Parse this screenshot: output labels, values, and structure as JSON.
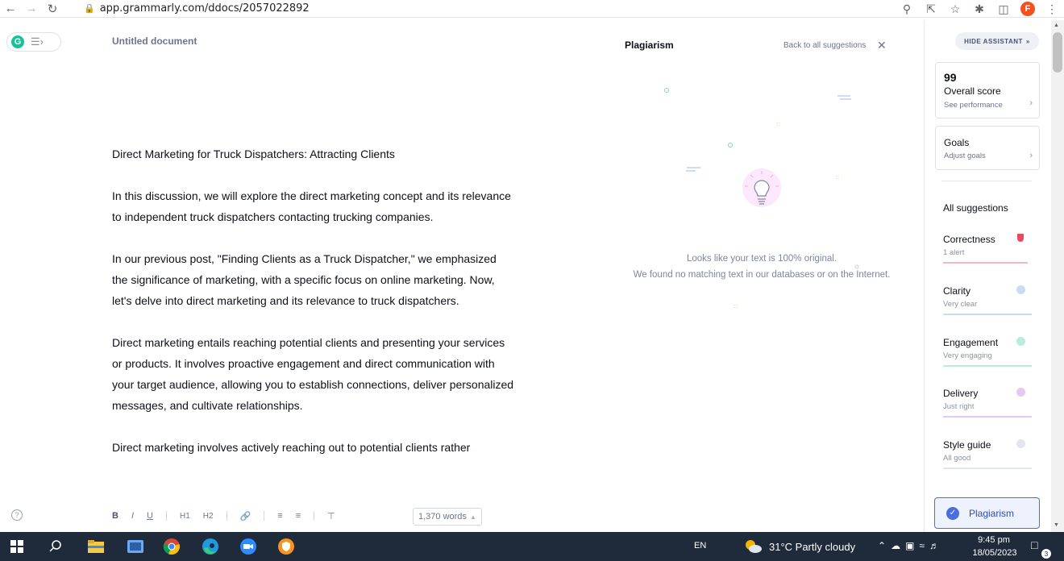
{
  "browser": {
    "url": "app.grammarly.com/ddocs/2057022892",
    "profile_initial": "F"
  },
  "app": {
    "logo_letter": "G",
    "doc_title": "Untitled document"
  },
  "document": {
    "paragraphs": [
      "Direct Marketing for Truck Dispatchers: Attracting Clients",
      "In this discussion, we will explore the direct marketing concept and its relevance to independent truck dispatchers contacting trucking companies.",
      "In our previous post, \"Finding Clients as a Truck Dispatcher,\" we emphasized the significance of marketing, with a specific focus on online marketing. Now, let's delve into direct marketing and its relevance to truck dispatchers.",
      "Direct marketing entails reaching potential clients and presenting your services or products. It involves proactive engagement and direct communication with your target audience, allowing you to establish connections, deliver personalized messages, and cultivate relationships.",
      "Direct marketing involves actively reaching out to potential clients rather"
    ]
  },
  "toolbar": {
    "bold": "B",
    "italic": "I",
    "underline": "U",
    "h1": "H1",
    "h2": "H2",
    "word_count": "1,370 words"
  },
  "plagiarism_panel": {
    "title": "Plagiarism",
    "back_link": "Back to all suggestions",
    "message_line1": "Looks like your text is 100% original.",
    "message_line2": "We found no matching text in our databases or on the Internet."
  },
  "sidebar": {
    "hide_button": "HIDE ASSISTANT",
    "score": {
      "value": "99",
      "label": "Overall score",
      "sub": "See performance"
    },
    "goals": {
      "label": "Goals",
      "sub": "Adjust goals"
    },
    "all_suggestions": "All suggestions",
    "metrics": [
      {
        "name": "Correctness",
        "status": "1 alert",
        "color": "#e84a5f"
      },
      {
        "name": "Clarity",
        "status": "Very clear",
        "color": "#4a90e2"
      },
      {
        "name": "Engagement",
        "status": "Very engaging",
        "color": "#15c39a"
      },
      {
        "name": "Delivery",
        "status": "Just right",
        "color": "#b561d9"
      },
      {
        "name": "Style guide",
        "status": "All good",
        "color": "#a7b0c3"
      }
    ],
    "plagiarism_button": "Plagiarism"
  },
  "taskbar": {
    "language": "EN",
    "weather": "31°C  Partly cloudy",
    "time": "9:45 pm",
    "date": "18/05/2023",
    "notification_count": "3"
  }
}
